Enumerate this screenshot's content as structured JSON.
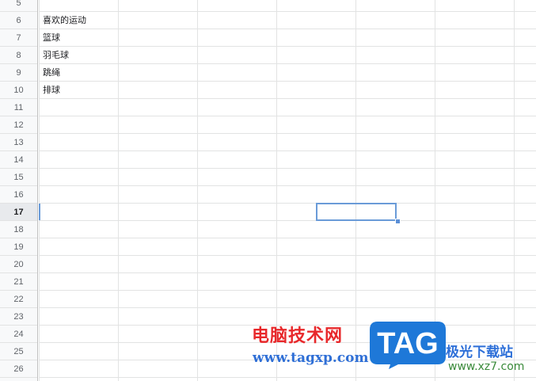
{
  "rows": [
    {
      "num": "5",
      "a": ""
    },
    {
      "num": "6",
      "a": "喜欢的运动"
    },
    {
      "num": "7",
      "a": "篮球"
    },
    {
      "num": "8",
      "a": "羽毛球"
    },
    {
      "num": "9",
      "a": "跳绳"
    },
    {
      "num": "10",
      "a": "排球"
    },
    {
      "num": "11",
      "a": ""
    },
    {
      "num": "12",
      "a": ""
    },
    {
      "num": "13",
      "a": ""
    },
    {
      "num": "14",
      "a": ""
    },
    {
      "num": "15",
      "a": ""
    },
    {
      "num": "16",
      "a": ""
    },
    {
      "num": "17",
      "a": ""
    },
    {
      "num": "18",
      "a": ""
    },
    {
      "num": "19",
      "a": ""
    },
    {
      "num": "20",
      "a": ""
    },
    {
      "num": "21",
      "a": ""
    },
    {
      "num": "22",
      "a": ""
    },
    {
      "num": "23",
      "a": ""
    },
    {
      "num": "24",
      "a": ""
    },
    {
      "num": "25",
      "a": ""
    },
    {
      "num": "26",
      "a": ""
    }
  ],
  "active_row": "17",
  "watermark": {
    "title": "电脑技术网",
    "url": "www.tagxp.com",
    "logo_text": "TAG",
    "right_title": "极光下载站",
    "right_url": "www.xz7.com"
  },
  "colors": {
    "selection": "#6a9bd8",
    "watermark_red": "#e8282b",
    "watermark_blue": "#2f6fd6"
  }
}
